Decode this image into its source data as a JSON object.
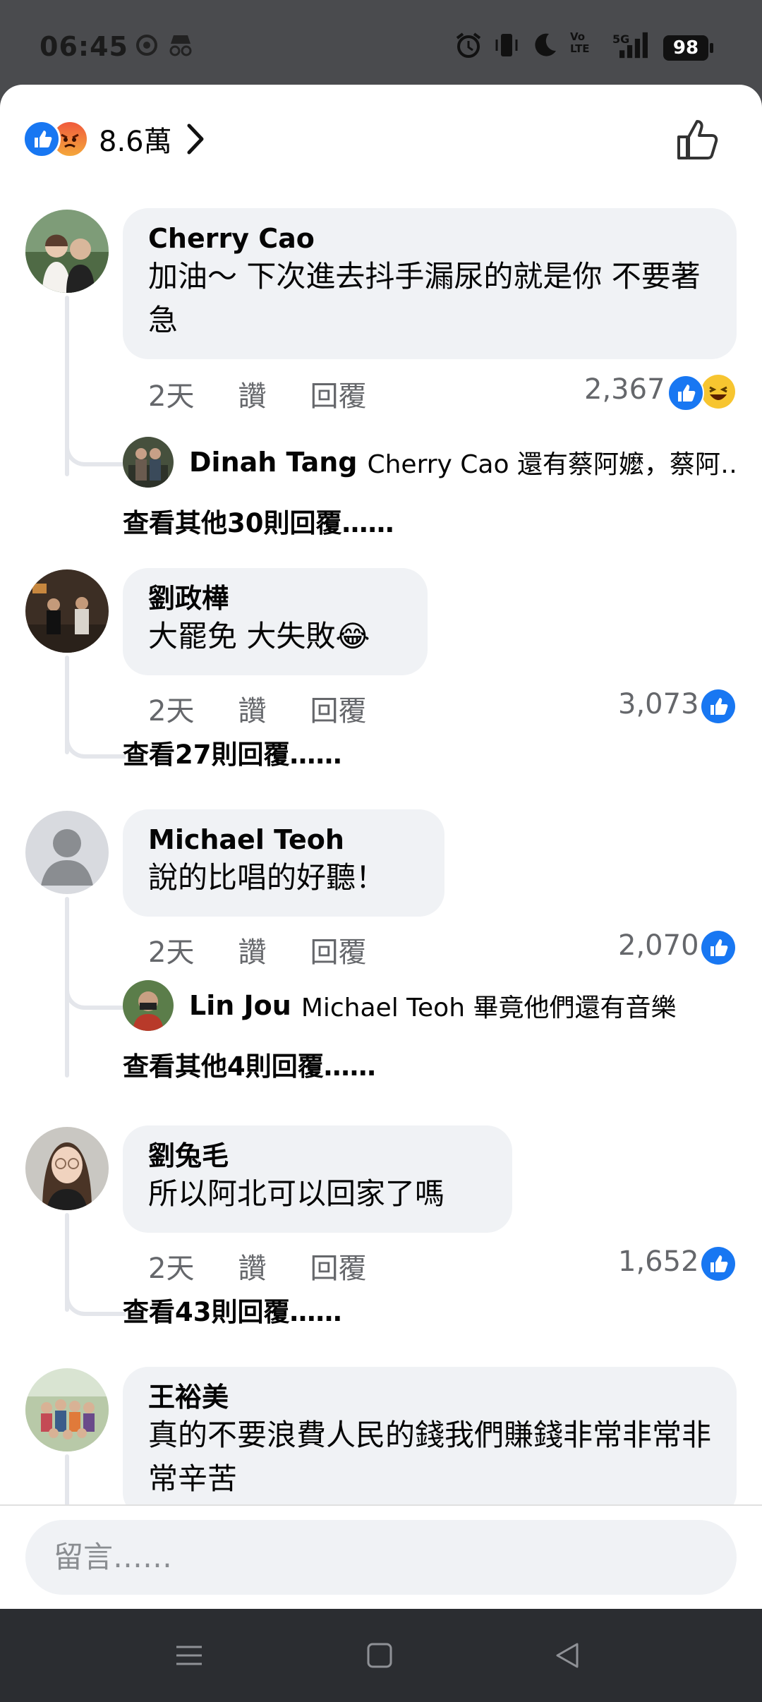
{
  "status_bar": {
    "time": "06:45",
    "network": "5G",
    "volte": "Vo LTE",
    "battery": "98"
  },
  "reactions_header": {
    "count": "8.6萬"
  },
  "comments": [
    {
      "name": "Cherry Cao",
      "text": "加油～ 下次進去抖手漏尿的就是你 不要著急",
      "time": "2天",
      "like": "讚",
      "reply": "回覆",
      "count": "2,367",
      "reply_preview": {
        "name": "Dinah Tang",
        "text": "Cherry Cao 還有蔡阿嬤，蔡阿…"
      },
      "more": "查看其他30則回覆……"
    },
    {
      "name": "劉政樺",
      "text": "大罷免 大失敗😂",
      "time": "2天",
      "like": "讚",
      "reply": "回覆",
      "count": "3,073",
      "more": "查看27則回覆……"
    },
    {
      "name": "Michael Teoh",
      "text": "說的比唱的好聽！",
      "time": "2天",
      "like": "讚",
      "reply": "回覆",
      "count": "2,070",
      "reply_preview": {
        "name": "Lin Jou",
        "text": "Michael Teoh 畢竟他們還有音樂"
      },
      "more": "查看其他4則回覆……"
    },
    {
      "name": "劉兔毛",
      "text": "所以阿北可以回家了嗎",
      "time": "2天",
      "like": "讚",
      "reply": "回覆",
      "count": "1,652",
      "more": "查看43則回覆……"
    },
    {
      "name": "王裕美",
      "text": "真的不要浪費人民的錢我們賺錢非常非常非常辛苦"
    }
  ],
  "composer": {
    "placeholder": "留言……"
  },
  "colors": {
    "accent": "#1877f2",
    "bubble": "#f0f2f5",
    "meta": "#65676b"
  }
}
